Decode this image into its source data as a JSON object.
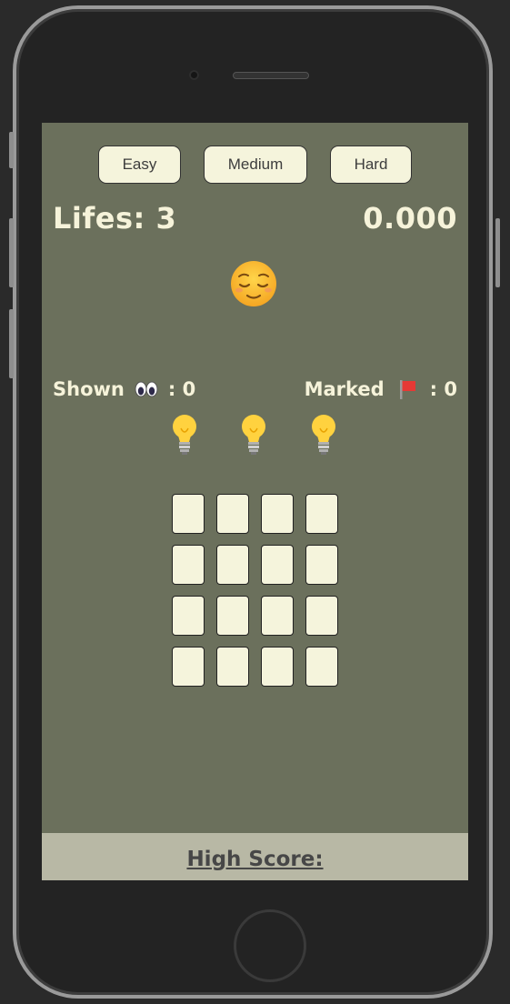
{
  "difficulty": {
    "easy_label": "Easy",
    "medium_label": "Medium",
    "hard_label": "Hard"
  },
  "status": {
    "lifes_label": "Lifes: 3",
    "timer": "0.000",
    "face_icon": "relieved-face-icon"
  },
  "counters": {
    "shown_label": "Shown",
    "shown_icon": "eyes-icon",
    "shown_value": ": 0",
    "marked_label": "Marked",
    "marked_icon": "red-flag-icon",
    "marked_value": ": 0"
  },
  "hints": {
    "count": 3,
    "icon": "lightbulb-icon"
  },
  "board": {
    "rows": 4,
    "cols": 4
  },
  "footer": {
    "high_score_label": "High Score:"
  },
  "colors": {
    "background": "#6b705c",
    "cell": "#f5f4dc",
    "text": "#f6f3da",
    "footer": "#b8b8a5"
  }
}
